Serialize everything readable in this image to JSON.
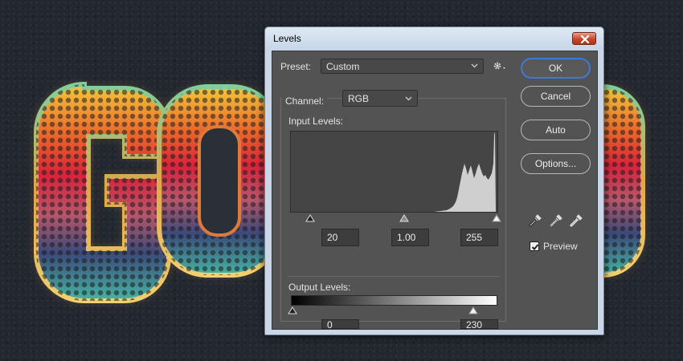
{
  "artwork": {
    "letters": [
      "G",
      "O",
      "O"
    ]
  },
  "dialog": {
    "title": "Levels",
    "preset_label": "Preset:",
    "preset_value": "Custom",
    "channel_label": "Channel:",
    "channel_value": "RGB",
    "input_levels_label": "Input Levels:",
    "output_levels_label": "Output Levels:",
    "input_black": "20",
    "input_gamma": "1.00",
    "input_white": "255",
    "output_black": "0",
    "output_white": "230",
    "buttons": {
      "ok": "OK",
      "cancel": "Cancel",
      "auto": "Auto",
      "options": "Options..."
    },
    "preview_label": "Preview",
    "preview_checked": true,
    "icons": [
      "close-icon",
      "chevron-down-icon",
      "gear-icon",
      "black-eyedropper-icon",
      "gray-eyedropper-icon",
      "white-eyedropper-icon",
      "checkmark-icon"
    ]
  },
  "colors": {
    "panel_bg": "#535353",
    "default_button_border": "#3c7ad8",
    "close_button": "#c9452a"
  }
}
